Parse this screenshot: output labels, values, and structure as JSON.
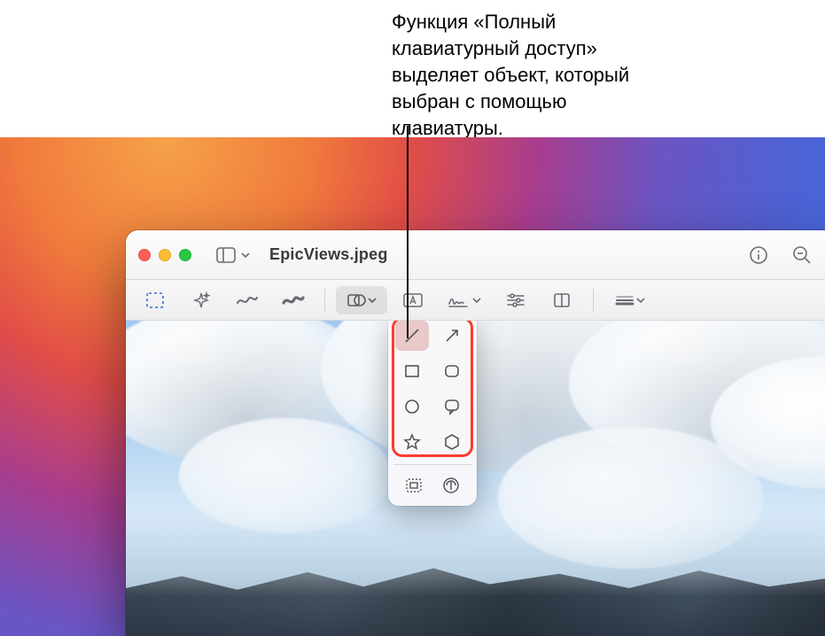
{
  "caption": "Функция «Полный клавиатурный доступ» выделяет объект, который выбран с помощью клавиатуры.",
  "window": {
    "filename": "EpicViews.jpeg"
  },
  "titlebar_icons": {
    "close": "close",
    "minimize": "minimize",
    "zoom": "zoom",
    "sidebar": "sidebar",
    "info": "info",
    "search": "search"
  },
  "toolbar": {
    "selection": "rectangular-selection",
    "instant_alpha": "instant-alpha",
    "sketch": "sketch",
    "draw": "draw",
    "shapes": "shapes",
    "text": "text",
    "sign": "sign",
    "adjust_color": "adjust-color",
    "crop": "crop",
    "more": "more"
  },
  "shapes_popover": {
    "items": [
      "line",
      "arrow",
      "rectangle",
      "rounded-rectangle",
      "oval",
      "speech-bubble",
      "star",
      "hexagon"
    ],
    "selected": "line",
    "extra": [
      "mask",
      "loupe"
    ]
  },
  "colors": {
    "focus_ring": "#ff3b30",
    "selected_bg": "#e9c9c9"
  }
}
